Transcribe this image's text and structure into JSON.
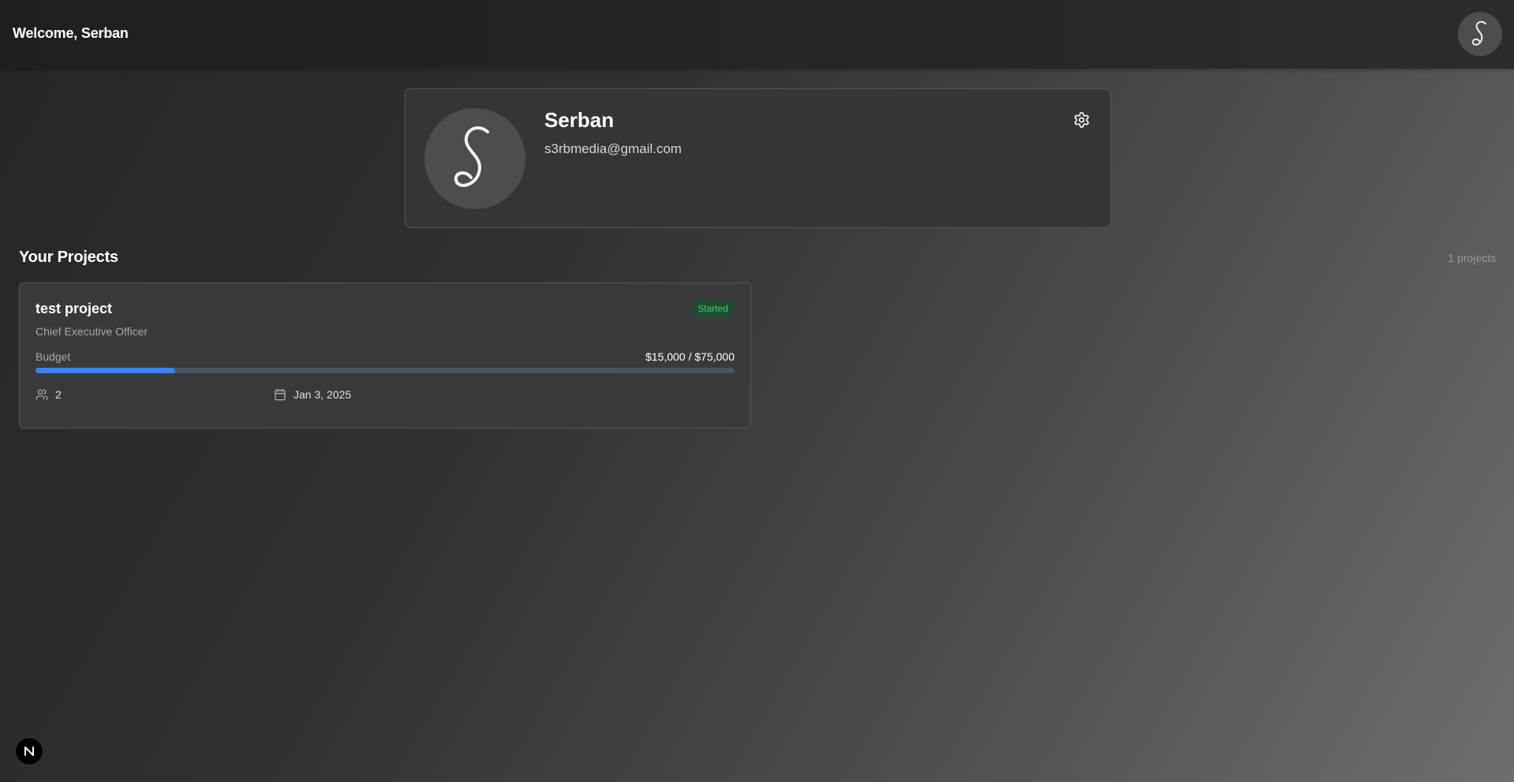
{
  "header": {
    "welcome_text": "Welcome, Serban",
    "avatar_letter": "S"
  },
  "profile": {
    "name": "Serban",
    "email": "s3rbmedia@gmail.com",
    "avatar_letter": "S"
  },
  "projects_section": {
    "title": "Your Projects",
    "count_label": "1 projects",
    "projects": [
      {
        "title": "test project",
        "status": "Started",
        "role": "Chief Executive Officer",
        "budget_label": "Budget",
        "budget_value": "$15,000 / $75,000",
        "budget_progress_fraction": 0.2,
        "members": "2",
        "date": "Jan 3, 2025"
      }
    ]
  },
  "dev_badge": {
    "letter": "N"
  },
  "colors": {
    "accent": "#3b82f6",
    "status_started_text": "#36d46b",
    "status_started_bg": "#234a32"
  },
  "icons": {
    "settings": "gear-icon",
    "members": "users-icon",
    "date": "calendar-icon"
  }
}
